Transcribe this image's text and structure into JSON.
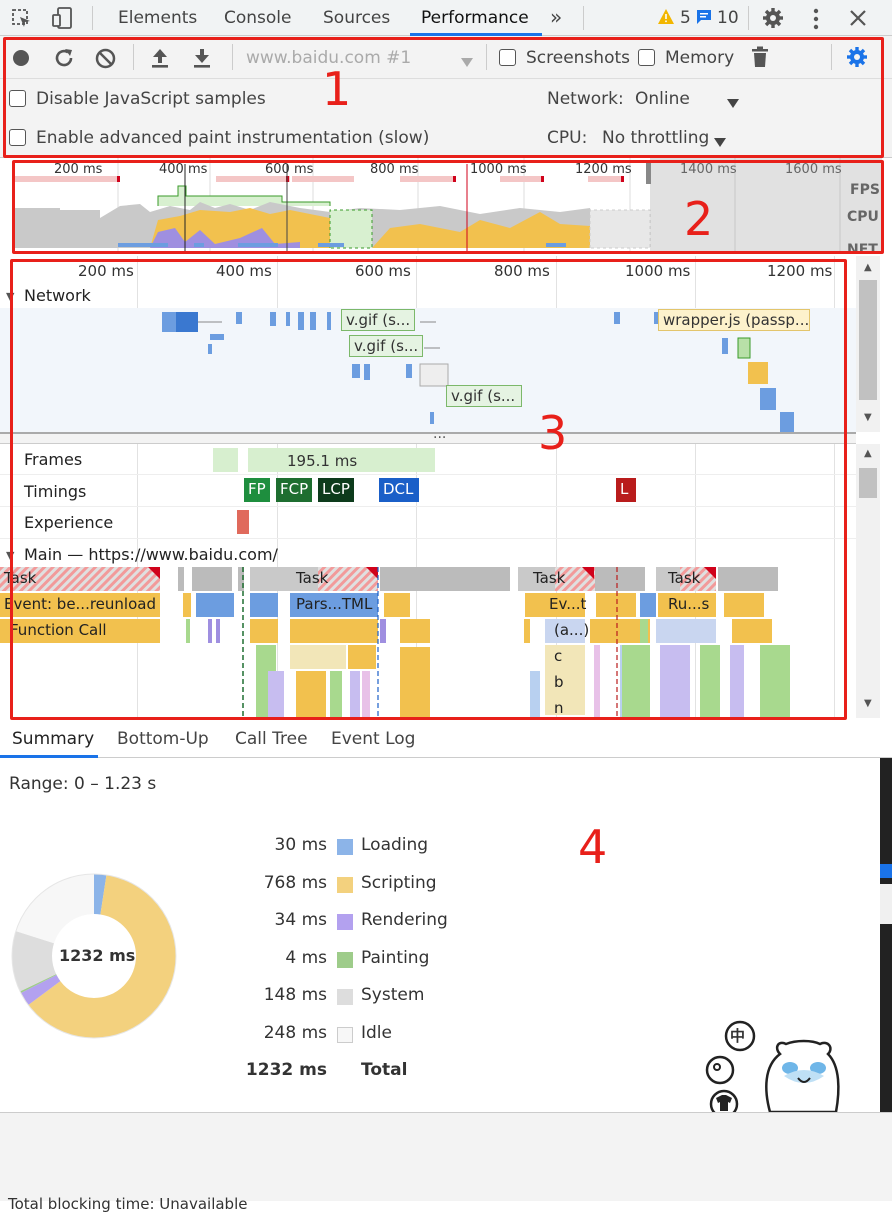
{
  "toolbar": {
    "tabs": [
      "Elements",
      "Console",
      "Sources",
      "Performance"
    ],
    "more_label": "»",
    "warning_count": "5",
    "message_count": "10"
  },
  "controls": {
    "profile_select": "www.baidu.com #1",
    "screenshots_label": "Screenshots",
    "memory_label": "Memory",
    "disable_js_label": "Disable JavaScript samples",
    "paint_label": "Enable advanced paint instrumentation (slow)",
    "network_label": "Network:",
    "network_value": "Online",
    "cpu_label": "CPU:",
    "cpu_value": "No throttling"
  },
  "annotations": [
    "1",
    "2",
    "3",
    "4"
  ],
  "overview": {
    "ticks": [
      "200 ms",
      "400 ms",
      "600 ms",
      "800 ms",
      "1000 ms",
      "1200 ms",
      "1400 ms",
      "1600 ms"
    ],
    "lanes": [
      "FPS",
      "CPU",
      "NET"
    ]
  },
  "timeline": {
    "ticks": [
      "200 ms",
      "400 ms",
      "600 ms",
      "800 ms",
      "1000 ms",
      "1200 ms"
    ],
    "network_label": "Network",
    "network_items": [
      "v.gif (s...",
      "v.gif (s...",
      "v.gif (s...",
      "wrapper.js (passp..."
    ],
    "more_indicator": "...",
    "frames_label": "Frames",
    "frame_value": "195.1 ms",
    "timings_label": "Timings",
    "timings": [
      "FP",
      "FCP",
      "LCP",
      "DCL",
      "L"
    ],
    "experience_label": "Experience",
    "main_label": "Main — https://www.baidu.com/",
    "flame": {
      "task": "Task",
      "event": "Event: be...reunload",
      "function_call": "Function Call",
      "parse": "Pars...TML",
      "evt": "Ev...t",
      "run": "Ru...s",
      "anon": "(a...)",
      "c": "c",
      "b": "b",
      "n": "n"
    }
  },
  "bottom_tabs": [
    "Summary",
    "Bottom-Up",
    "Call Tree",
    "Event Log"
  ],
  "summary": {
    "range": "Range: 0 – 1.23 s",
    "total_center": "1232 ms",
    "rows": [
      {
        "value": "30 ms",
        "label": "Loading",
        "color": "#8cb4e8"
      },
      {
        "value": "768 ms",
        "label": "Scripting",
        "color": "#f3d17e"
      },
      {
        "value": "34 ms",
        "label": "Rendering",
        "color": "#b3a1ef"
      },
      {
        "value": "4 ms",
        "label": "Painting",
        "color": "#9ecc8a"
      },
      {
        "value": "148 ms",
        "label": "System",
        "color": "#dddddd"
      },
      {
        "value": "248 ms",
        "label": "Idle",
        "color": "#f7f7f7"
      }
    ],
    "total_value": "1232 ms",
    "total_label": "Total"
  },
  "sticker": {
    "text": "中"
  },
  "footer": {
    "text": "Total blocking time: Unavailable"
  }
}
